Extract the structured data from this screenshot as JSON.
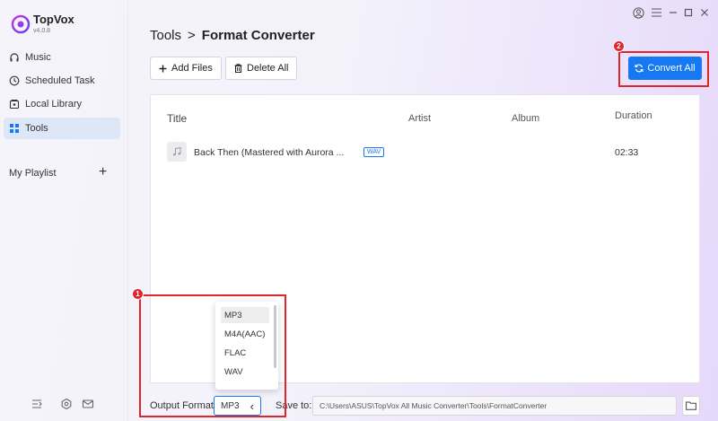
{
  "app": {
    "name": "TopVox",
    "version": "v4.0.8"
  },
  "sidebar": {
    "items": [
      {
        "label": "Music",
        "icon": "headphones-icon"
      },
      {
        "label": "Scheduled Task",
        "icon": "clock-icon"
      },
      {
        "label": "Local Library",
        "icon": "library-icon"
      },
      {
        "label": "Tools",
        "icon": "grid-icon",
        "active": true
      }
    ],
    "playlist_label": "My Playlist",
    "playlist_add": "+"
  },
  "header": {
    "breadcrumb_root": "Tools",
    "breadcrumb_sep": ">",
    "breadcrumb_current": "Format Converter",
    "add_files_label": "Add Files",
    "delete_all_label": "Delete All",
    "convert_all_label": "Convert All"
  },
  "table": {
    "columns": {
      "title": "Title",
      "artist": "Artist",
      "album": "Album",
      "duration": "Duration"
    },
    "rows": [
      {
        "title": "Back Then (Mastered with Aurora ...",
        "format": "WAV",
        "artist": "",
        "album": "",
        "duration": "02:33"
      }
    ]
  },
  "bottom": {
    "output_format_label": "Output Format:",
    "output_format_value": "MP3",
    "output_format_arrow": "‹",
    "save_to_label": "Save to:",
    "save_path": "C:\\Users\\ASUS\\TopVox All Music Converter\\Tools\\FormatConverter"
  },
  "dropdown": {
    "options": [
      "MP3",
      "M4A(AAC)",
      "FLAC",
      "WAV"
    ],
    "selected": "MP3"
  },
  "annotations": {
    "badge1": "1",
    "badge2": "2"
  },
  "colors": {
    "accent": "#1678f2",
    "highlight": "#e0262b",
    "active_nav": "#dde7f7"
  }
}
